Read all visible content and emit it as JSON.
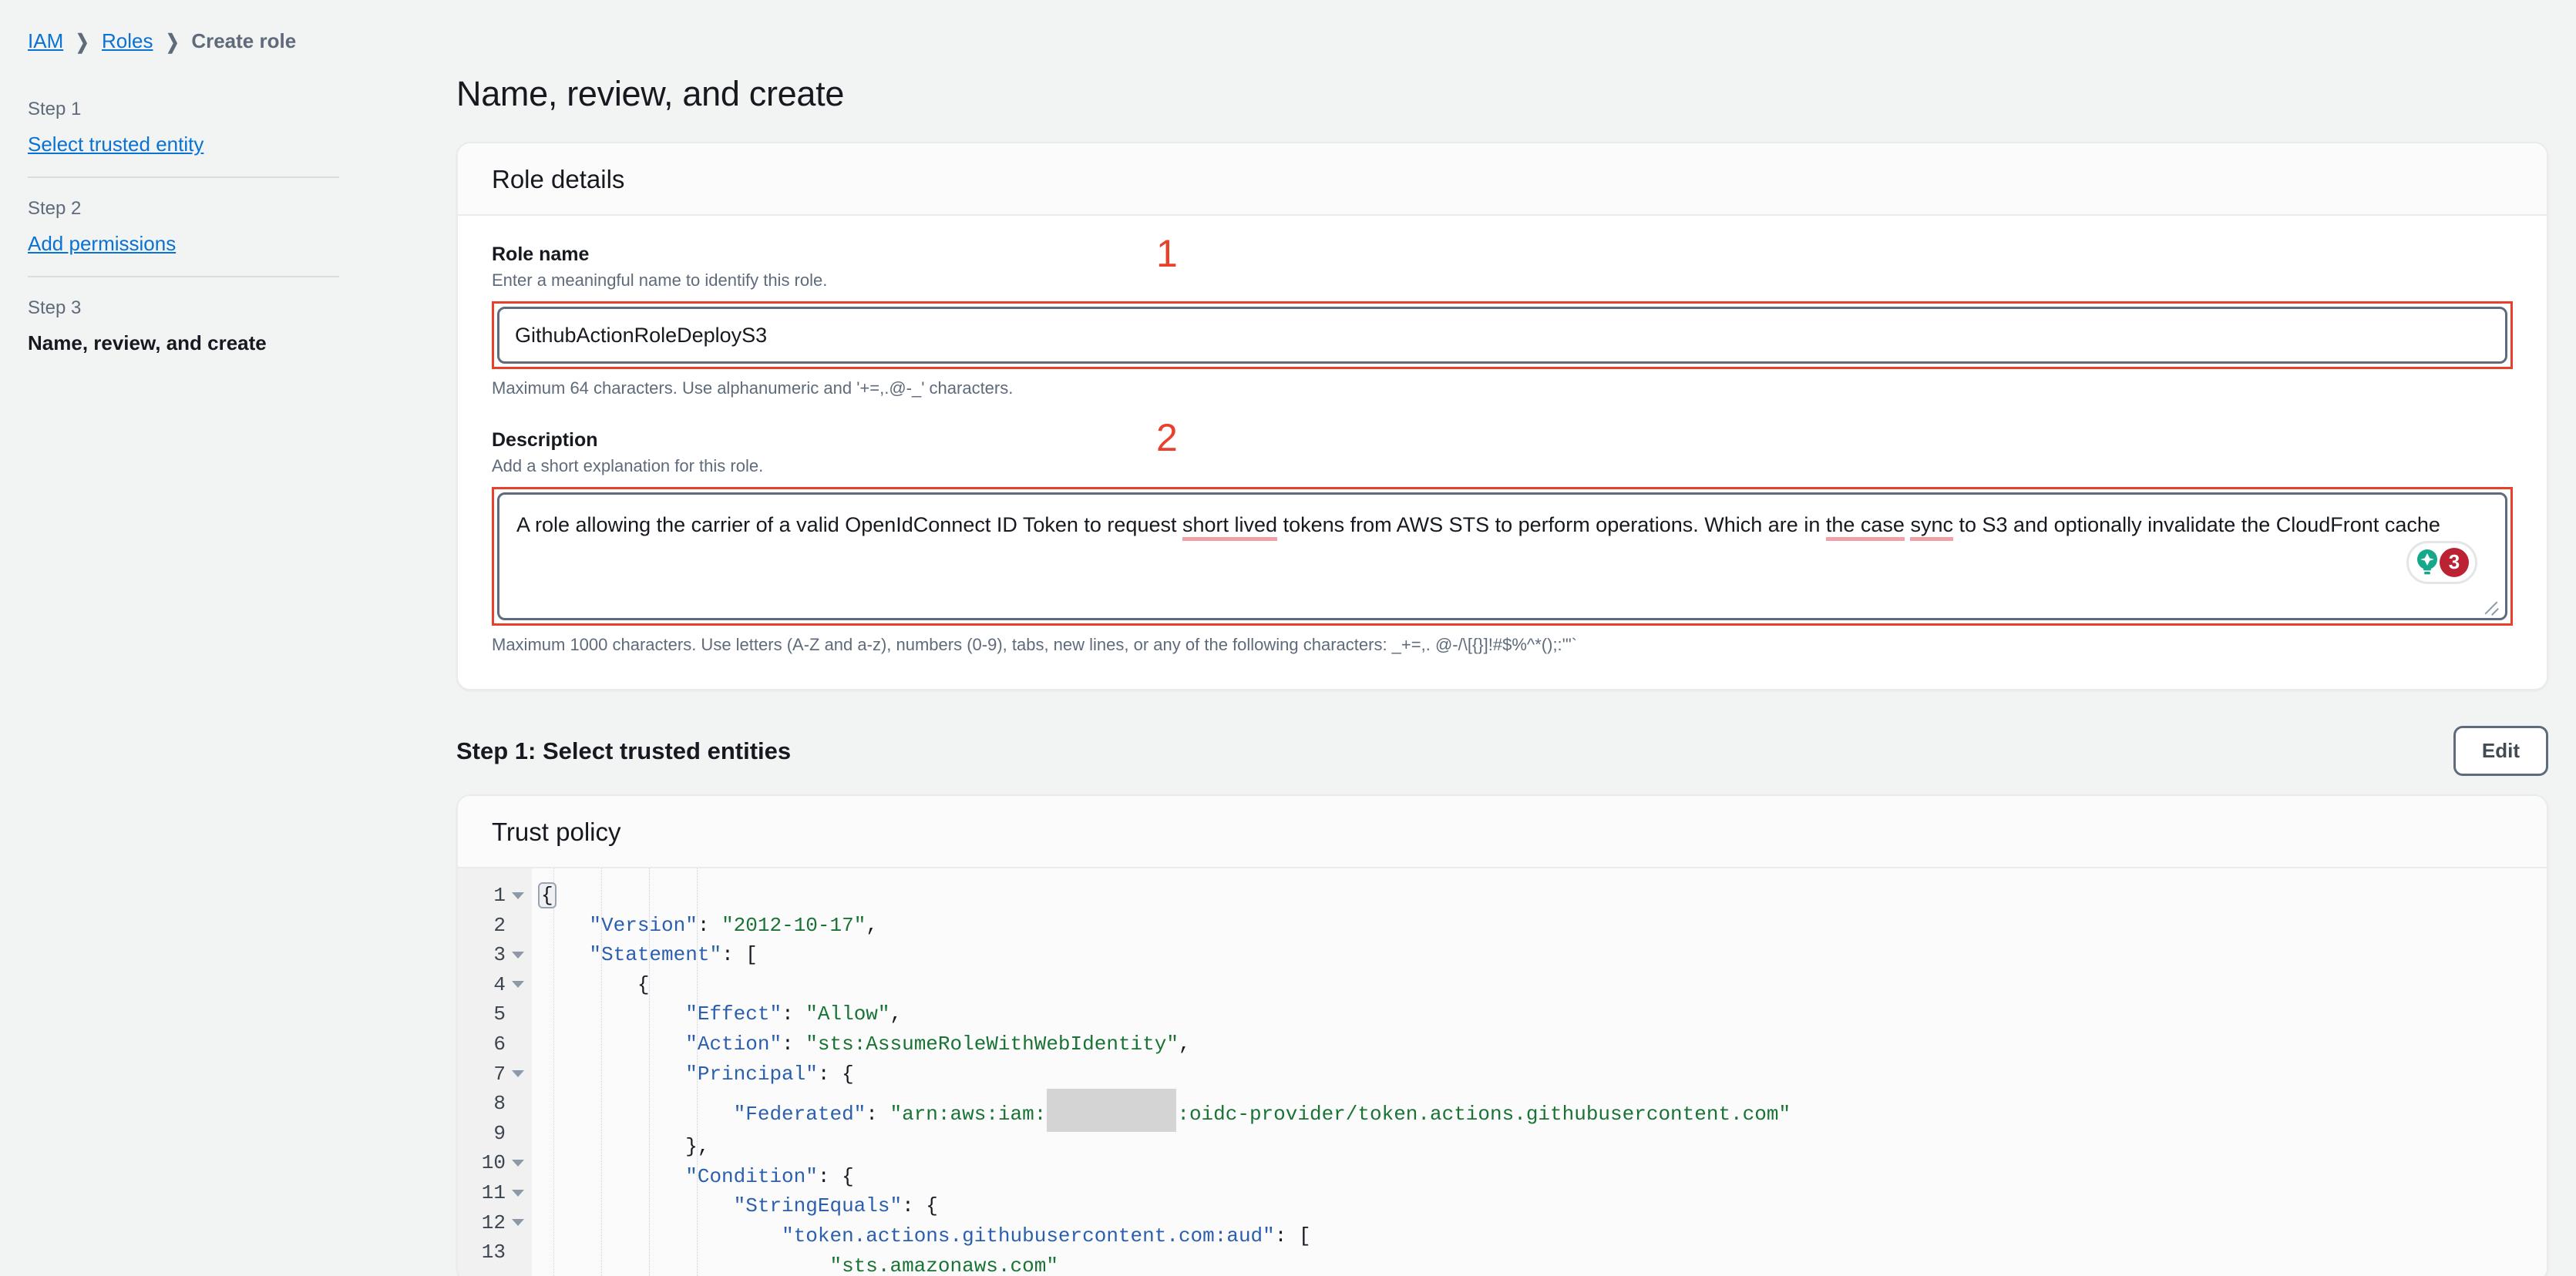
{
  "breadcrumb": {
    "items": [
      {
        "label": "IAM",
        "type": "link"
      },
      {
        "label": "Roles",
        "type": "link"
      },
      {
        "label": "Create role",
        "type": "current"
      }
    ],
    "separator": "❯"
  },
  "sidebar": {
    "steps": [
      {
        "step_label": "Step 1",
        "name": "Select trusted entity",
        "state": "link"
      },
      {
        "step_label": "Step 2",
        "name": "Add permissions",
        "state": "link"
      },
      {
        "step_label": "Step 3",
        "name": "Name, review, and create",
        "state": "active"
      }
    ]
  },
  "main": {
    "page_title": "Name, review, and create",
    "role_details": {
      "card_title": "Role details",
      "role_name": {
        "label": "Role name",
        "description": "Enter a meaningful name to identify this role.",
        "value": "GithubActionRoleDeployS3",
        "hint": "Maximum 64 characters. Use alphanumeric and '+=,.@-_' characters.",
        "annotation": "1"
      },
      "description_field": {
        "label": "Description",
        "description": "Add a short explanation for this role.",
        "value_part1": "A role allowing the carrier of a valid OpenIdConnect ID Token to request ",
        "value_err1": "short lived",
        "value_part2": " tokens from AWS STS to perform operations. Which are in ",
        "value_err2": "the case",
        "value_err3": "sync",
        "value_part3": " to S3 and optionally invalidate the CloudFront cache",
        "hint": "Maximum 1000 characters. Use letters (A-Z and a-z), numbers (0-9), tabs, new lines, or any of the following characters: _+=,. @-/\\[{}]!#$%^*();:'\"`",
        "annotation": "2",
        "grammarly_count": "3"
      }
    },
    "step1_section": {
      "title": "Step 1: Select trusted entities",
      "edit_button": "Edit",
      "trust_policy": {
        "card_title": "Trust policy",
        "lines": [
          {
            "num": "1",
            "fold": true,
            "tokens": [
              {
                "t": "{",
                "c": "brace-hl"
              }
            ]
          },
          {
            "num": "2",
            "fold": false,
            "tokens": [
              {
                "t": "    ",
                "c": "p"
              },
              {
                "t": "\"Version\"",
                "c": "k"
              },
              {
                "t": ": ",
                "c": "p"
              },
              {
                "t": "\"2012-10-17\"",
                "c": "s"
              },
              {
                "t": ",",
                "c": "p"
              }
            ]
          },
          {
            "num": "3",
            "fold": true,
            "tokens": [
              {
                "t": "    ",
                "c": "p"
              },
              {
                "t": "\"Statement\"",
                "c": "k"
              },
              {
                "t": ": [",
                "c": "p"
              }
            ]
          },
          {
            "num": "4",
            "fold": true,
            "tokens": [
              {
                "t": "        {",
                "c": "p"
              }
            ]
          },
          {
            "num": "5",
            "fold": false,
            "tokens": [
              {
                "t": "            ",
                "c": "p"
              },
              {
                "t": "\"Effect\"",
                "c": "k"
              },
              {
                "t": ": ",
                "c": "p"
              },
              {
                "t": "\"Allow\"",
                "c": "s"
              },
              {
                "t": ",",
                "c": "p"
              }
            ]
          },
          {
            "num": "6",
            "fold": false,
            "tokens": [
              {
                "t": "            ",
                "c": "p"
              },
              {
                "t": "\"Action\"",
                "c": "k"
              },
              {
                "t": ": ",
                "c": "p"
              },
              {
                "t": "\"sts:AssumeRoleWithWebIdentity\"",
                "c": "s"
              },
              {
                "t": ",",
                "c": "p"
              }
            ]
          },
          {
            "num": "7",
            "fold": true,
            "tokens": [
              {
                "t": "            ",
                "c": "p"
              },
              {
                "t": "\"Principal\"",
                "c": "k"
              },
              {
                "t": ": {",
                "c": "p"
              }
            ]
          },
          {
            "num": "8",
            "fold": false,
            "tokens": [
              {
                "t": "                ",
                "c": "p"
              },
              {
                "t": "\"Federated\"",
                "c": "k"
              },
              {
                "t": ": ",
                "c": "p"
              },
              {
                "t": "\"arn:aws:iam:",
                "c": "s"
              },
              {
                "t": "",
                "c": "redact"
              },
              {
                "t": ":oidc-provider/token.actions.githubusercontent.com\"",
                "c": "s"
              }
            ]
          },
          {
            "num": "9",
            "fold": false,
            "tokens": [
              {
                "t": "            },",
                "c": "p"
              }
            ]
          },
          {
            "num": "10",
            "fold": true,
            "tokens": [
              {
                "t": "            ",
                "c": "p"
              },
              {
                "t": "\"Condition\"",
                "c": "k"
              },
              {
                "t": ": {",
                "c": "p"
              }
            ]
          },
          {
            "num": "11",
            "fold": true,
            "tokens": [
              {
                "t": "                ",
                "c": "p"
              },
              {
                "t": "\"StringEquals\"",
                "c": "k"
              },
              {
                "t": ": {",
                "c": "p"
              }
            ]
          },
          {
            "num": "12",
            "fold": true,
            "tokens": [
              {
                "t": "                    ",
                "c": "p"
              },
              {
                "t": "\"token.actions.githubusercontent.com:aud\"",
                "c": "k"
              },
              {
                "t": ": [",
                "c": "p"
              }
            ]
          },
          {
            "num": "13",
            "fold": false,
            "tokens": [
              {
                "t": "                        ",
                "c": "p"
              },
              {
                "t": "\"sts.amazonaws.com\"",
                "c": "s"
              }
            ]
          }
        ]
      }
    }
  },
  "colors": {
    "link": "#0972d3",
    "annotation_red": "#e8402a",
    "json_key": "#2b5fad",
    "json_string": "#197335",
    "grammarly_green": "#15a88a",
    "grammarly_badge": "#bb2233"
  }
}
